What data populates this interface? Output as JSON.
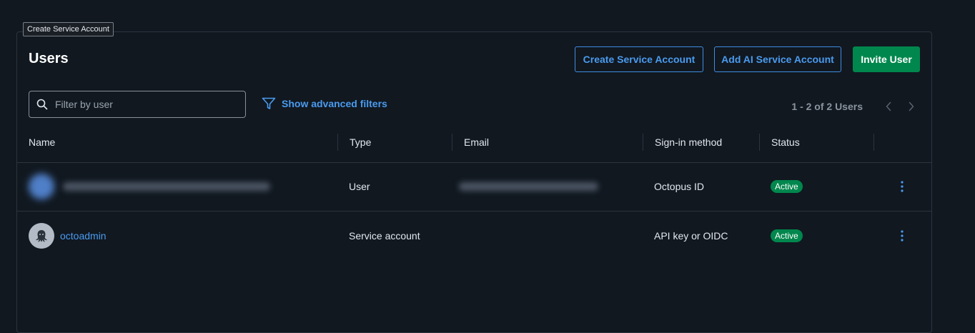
{
  "tooltip": {
    "text": "Create Service Account"
  },
  "header": {
    "title": "Users",
    "create_service_account_label": "Create Service Account",
    "add_ai_service_account_label": "Add AI Service Account",
    "invite_user_label": "Invite User"
  },
  "filters": {
    "search_placeholder": "Filter by user",
    "search_value": "",
    "advanced_filters_label": "Show advanced filters"
  },
  "pagination": {
    "summary": "1 - 2 of 2 Users"
  },
  "table": {
    "columns": [
      "Name",
      "Type",
      "Email",
      "Sign-in method",
      "Status"
    ],
    "rows": [
      {
        "name": "",
        "type": "User",
        "email": "",
        "sign_in_method": "Octopus ID",
        "status": "Active"
      },
      {
        "name": "octoadmin",
        "type": "Service account",
        "email": "",
        "sign_in_method": "API key or OIDC",
        "status": "Active"
      }
    ]
  },
  "colors": {
    "background": "#111820",
    "accent_blue": "#4a9bef",
    "primary_green": "#00874d",
    "border": "#2c343e"
  },
  "icons": {
    "search": "search-icon",
    "filter": "filter-icon",
    "prev": "chevron-left-icon",
    "next": "chevron-right-icon",
    "row_menu": "more-vertical-icon",
    "avatar": "octopus-icon"
  }
}
